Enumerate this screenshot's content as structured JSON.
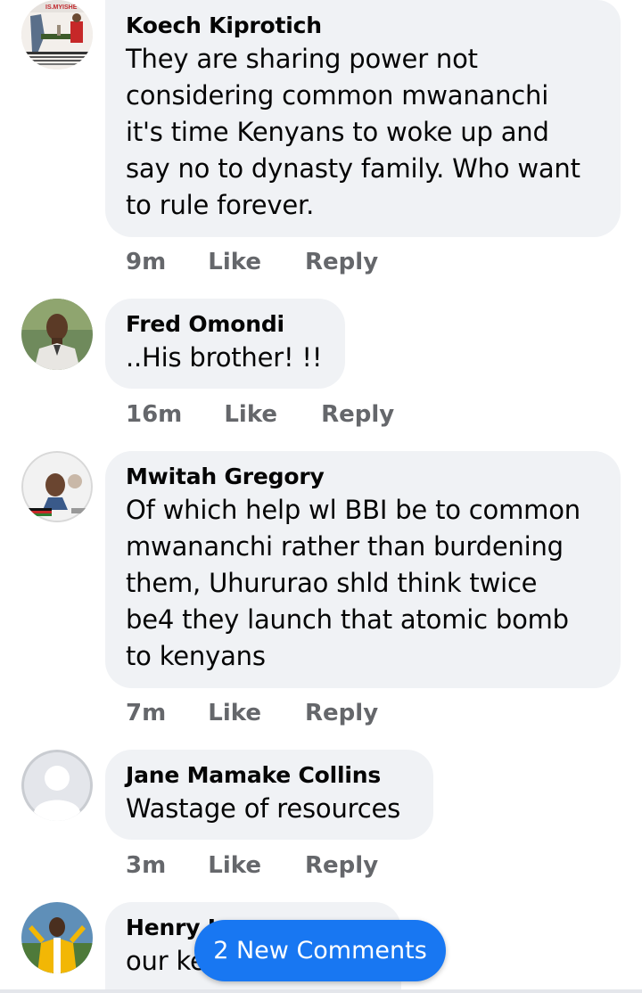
{
  "comments": [
    {
      "author": "Koech Kiprotich",
      "text": "They are sharing power not\nconsidering common mwananchi\nit's time Kenyans to woke up and\nsay no to dynasty family. Who want\nto rule forever.",
      "time": "9m",
      "like_label": "Like",
      "reply_label": "Reply",
      "avatar_text": "IS.MYISHE"
    },
    {
      "author": "Fred Omondi",
      "text": "..His brother! !!",
      "time": "16m",
      "like_label": "Like",
      "reply_label": "Reply"
    },
    {
      "author": "Mwitah Gregory",
      "text": "Of which help wl BBI be to common\nmwananchi rather than burdening\nthem, Uhururao shld think twice\nbe4 they launch that atomic bomb\nto kenyans",
      "time": "7m",
      "like_label": "Like",
      "reply_label": "Reply"
    },
    {
      "author": "Jane Mamake Collins",
      "text": "Wastage of resources",
      "time": "3m",
      "like_label": "Like",
      "reply_label": "Reply"
    },
    {
      "author": "Henry I",
      "text": "our ke"
    }
  ],
  "new_comments_button": "2 New Comments"
}
